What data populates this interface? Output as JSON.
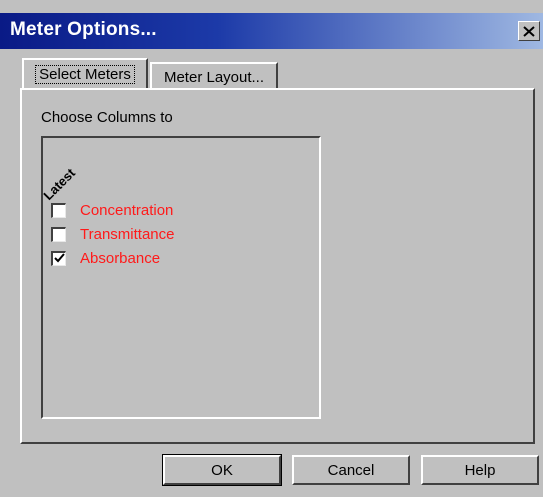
{
  "window": {
    "title": "Meter Options..."
  },
  "tabs": [
    {
      "label": "Select Meters",
      "selected": true
    },
    {
      "label": "Meter Layout...",
      "selected": false
    }
  ],
  "panel": {
    "choose_label": "Choose Columns to",
    "column_header": "Latest",
    "options": [
      {
        "label": "Concentration",
        "checked": false
      },
      {
        "label": "Transmittance",
        "checked": false
      },
      {
        "label": "Absorbance",
        "checked": true
      }
    ],
    "option_color": "#ff1a1a"
  },
  "buttons": {
    "ok": "OK",
    "cancel": "Cancel",
    "help": "Help"
  },
  "icons": {
    "close": "close-icon",
    "check": "checkmark-icon"
  }
}
